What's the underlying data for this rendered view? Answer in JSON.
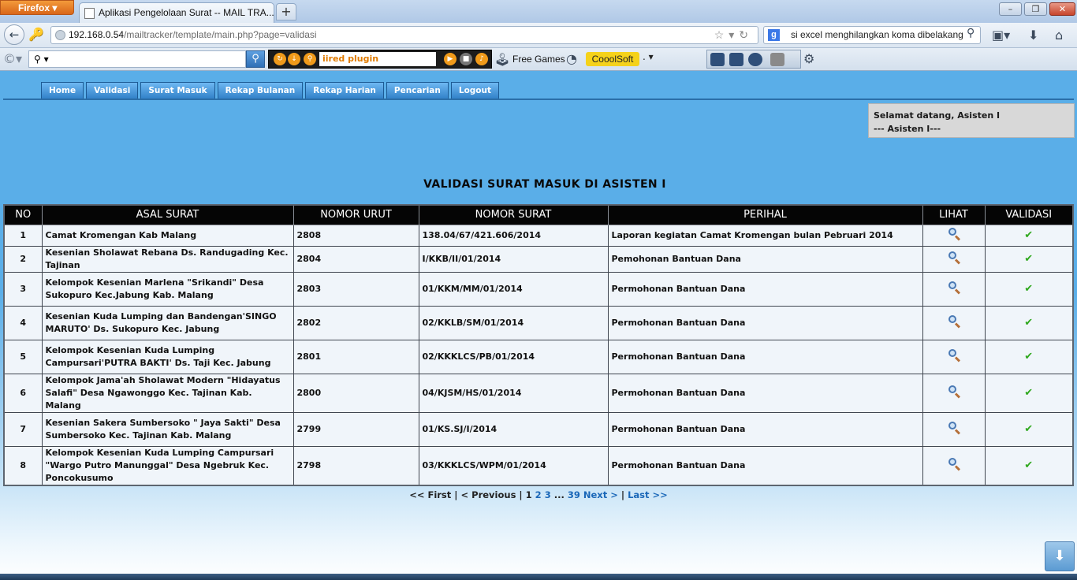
{
  "browser": {
    "menu_button": "Firefox",
    "tab_title": "Aplikasi Pengelolaan Surat -- MAIL TRA...",
    "new_tab": "+",
    "url_host": "192.168.0.54",
    "url_path": "/mailtracker/template/main.php?page=validasi",
    "search_query": "si excel menghilangkan koma dibelakang",
    "search_engine_icon": "google-icon"
  },
  "toolbar": {
    "search_placeholder": "",
    "radio_text": "iired plugin",
    "free_games": "Free Games",
    "cool_soft": "CooolSoft",
    "dot": "."
  },
  "menu": {
    "items": [
      {
        "label": "Home"
      },
      {
        "label": "Validasi"
      },
      {
        "label": "Surat Masuk"
      },
      {
        "label": "Rekap Bulanan"
      },
      {
        "label": "Rekap Harian"
      },
      {
        "label": "Pencarian"
      },
      {
        "label": "Logout"
      }
    ]
  },
  "welcome": {
    "line1": "Selamat datang, Asisten I",
    "line2": "--- Asisten I---"
  },
  "page_title": "VALIDASI SURAT MASUK DI ASISTEN I",
  "table": {
    "headers": [
      "NO",
      "ASAL SURAT",
      "NOMOR URUT",
      "NOMOR SURAT",
      "PERIHAL",
      "LIHAT",
      "VALIDASI"
    ],
    "rows": [
      {
        "no": "1",
        "asal": "Camat Kromengan Kab Malang",
        "urut": "2808",
        "nomor": "138.04/67/421.606/2014",
        "perihal": "Laporan kegiatan Camat Kromengan bulan Pebruari 2014"
      },
      {
        "no": "2",
        "asal": "Kesenian Sholawat Rebana Ds. Randugading Kec. Tajinan",
        "urut": "2804",
        "nomor": "I/KKB/II/01/2014",
        "perihal": "Pemohonan Bantuan Dana"
      },
      {
        "no": "3",
        "asal": "Kelompok Kesenian Marlena \"Srikandi\" Desa Sukopuro Kec.Jabung Kab. Malang",
        "urut": "2803",
        "nomor": "01/KKM/MM/01/2014",
        "perihal": "Permohonan Bantuan Dana"
      },
      {
        "no": "4",
        "asal": "Kesenian Kuda Lumping dan Bandengan'SINGO MARUTO' Ds. Sukopuro Kec. Jabung",
        "urut": "2802",
        "nomor": "02/KKLB/SM/01/2014",
        "perihal": "Permohonan Bantuan Dana"
      },
      {
        "no": "5",
        "asal": "Kelompok Kesenian Kuda Lumping Campursari'PUTRA BAKTI' Ds. Taji Kec. Jabung",
        "urut": "2801",
        "nomor": "02/KKKLCS/PB/01/2014",
        "perihal": "Permohonan Bantuan Dana"
      },
      {
        "no": "6",
        "asal": "Kelompok Jama'ah Sholawat Modern \"Hidayatus Salafi\" Desa Ngawonggo Kec. Tajinan Kab. Malang",
        "urut": "2800",
        "nomor": "04/KJSM/HS/01/2014",
        "perihal": "Permohonan Bantuan Dana"
      },
      {
        "no": "7",
        "asal": "Kesenian Sakera Sumbersoko \" Jaya Sakti\" Desa Sumbersoko Kec. Tajinan Kab. Malang",
        "urut": "2799",
        "nomor": "01/KS.SJ/I/2014",
        "perihal": "Permohonan Bantuan Dana"
      },
      {
        "no": "8",
        "asal": "Kelompok Kesenian Kuda Lumping Campursari \"Wargo Putro Manunggal\" Desa Ngebruk Kec. Poncokusumo",
        "urut": "2798",
        "nomor": "03/KKKLCS/WPM/01/2014",
        "perihal": "Permohonan Bantuan Dana"
      }
    ],
    "validate_glyph": "✔"
  },
  "pager": {
    "first": "<< First",
    "sep1": " | ",
    "previous": "< Previous",
    "sep2": " | ",
    "current": "1",
    "p2": "2",
    "p3": "3",
    "ellipsis": " ... ",
    "p39": "39",
    "next": "Next >",
    "sep3": " | ",
    "last": "Last >>"
  }
}
